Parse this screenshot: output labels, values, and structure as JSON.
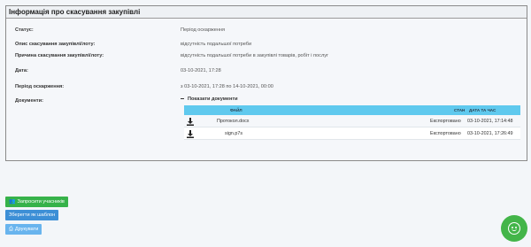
{
  "panel": {
    "title": "Інформація про скасування закупівлі",
    "fields": [
      {
        "label": "Статус:",
        "value": "Період оскарження"
      },
      {
        "label": "Опис скасування закупівлі/лоту:",
        "value": "відсутність подальшої потреби"
      },
      {
        "label": "Причина скасування закупівлі/лоту:",
        "value": "відсутність подальшої потреби в закупівлі товарів, робіт і послуг"
      },
      {
        "label": "Дата:",
        "value": "03-10-2021, 17:28"
      },
      {
        "label": "Період оскарження:",
        "value": "з 03-10-2021, 17:28 по 14-10-2021, 00:00"
      },
      {
        "label": "Документи:",
        "value": ""
      }
    ]
  },
  "documents": {
    "toggle_label": "Показати документи",
    "headers": {
      "file": "ФАЙЛ",
      "state": "СТАН",
      "datetime": "ДАТА ТА ЧАС"
    },
    "rows": [
      {
        "icon": "download-icon",
        "file": "Протокол.docx",
        "state": "Експортовано",
        "datetime": "03-10-2021, 17:14:48"
      },
      {
        "icon": "download-icon",
        "file": "sign.p7s",
        "state": "Експортовано",
        "datetime": "03-10-2021, 17:26:49"
      }
    ]
  },
  "actions": {
    "invite_label": "Запросити учасників",
    "save_template_label": "Зберегти як шаблон",
    "print_label": "Друкувати"
  },
  "colors": {
    "accent_green": "#36b24a",
    "accent_blue": "#3d8fd6",
    "table_header": "#5fc9ee"
  }
}
